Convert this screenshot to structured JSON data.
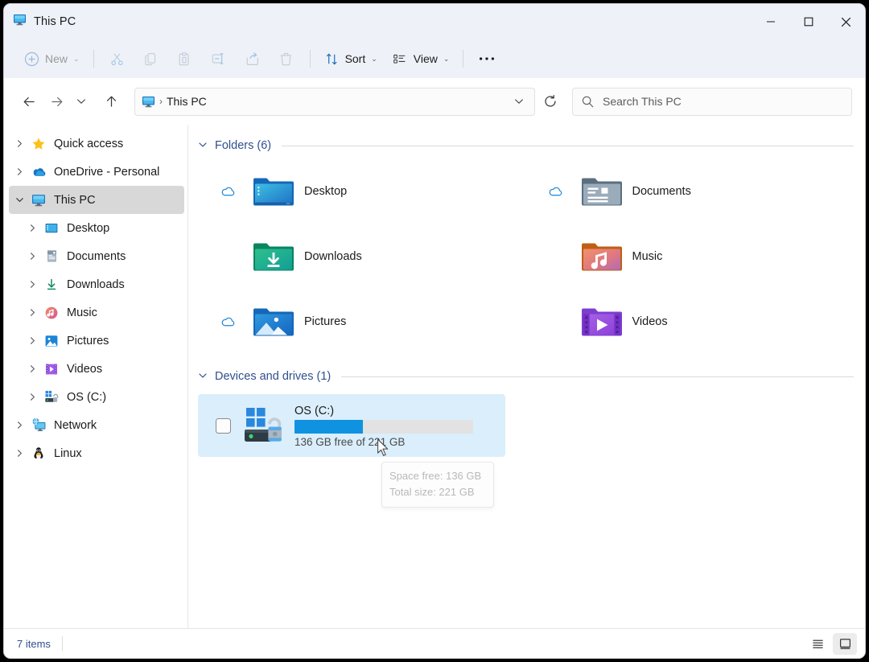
{
  "window": {
    "title": "This PC",
    "controls": {
      "minimize": "–",
      "maximize": "□",
      "close": "✕"
    }
  },
  "toolbar": {
    "new_label": "New",
    "cut_label": "Cut",
    "copy_label": "Copy",
    "paste_label": "Paste",
    "rename_label": "Rename",
    "share_label": "Share",
    "delete_label": "Delete",
    "sort_label": "Sort",
    "view_label": "View",
    "more_label": "See more"
  },
  "navigation": {
    "back": "Back",
    "forward": "Forward",
    "recent": "Recent locations",
    "up": "Up to parent",
    "breadcrumb": {
      "icon": "this-pc-icon",
      "separator": "›",
      "label": "This PC"
    },
    "address_dropdown": "Previous locations",
    "refresh": "Refresh"
  },
  "search": {
    "placeholder": "Search This PC",
    "value": ""
  },
  "sidebar": {
    "items": [
      {
        "label": "Quick access",
        "icon": "star-icon",
        "level": 1,
        "expander": "collapsed",
        "selected": false
      },
      {
        "label": "OneDrive - Personal",
        "icon": "onedrive-icon",
        "level": 1,
        "expander": "collapsed",
        "selected": false
      },
      {
        "label": "This PC",
        "icon": "this-pc-icon",
        "level": 1,
        "expander": "expanded",
        "selected": true
      },
      {
        "label": "Desktop",
        "icon": "desktop-icon",
        "level": 2,
        "expander": "collapsed",
        "selected": false
      },
      {
        "label": "Documents",
        "icon": "documents-icon",
        "level": 2,
        "expander": "collapsed",
        "selected": false
      },
      {
        "label": "Downloads",
        "icon": "downloads-icon",
        "level": 2,
        "expander": "collapsed",
        "selected": false
      },
      {
        "label": "Music",
        "icon": "music-icon",
        "level": 2,
        "expander": "collapsed",
        "selected": false
      },
      {
        "label": "Pictures",
        "icon": "pictures-icon",
        "level": 2,
        "expander": "collapsed",
        "selected": false
      },
      {
        "label": "Videos",
        "icon": "videos-icon",
        "level": 2,
        "expander": "collapsed",
        "selected": false
      },
      {
        "label": "OS (C:)",
        "icon": "drive-icon",
        "level": 2,
        "expander": "collapsed",
        "selected": false
      },
      {
        "label": "Network",
        "icon": "network-icon",
        "level": 1,
        "expander": "collapsed",
        "selected": false
      },
      {
        "label": "Linux",
        "icon": "linux-icon",
        "level": 1,
        "expander": "collapsed",
        "selected": false
      }
    ]
  },
  "main": {
    "groups": [
      {
        "title": "Folders (6)",
        "chevron": "expanded"
      },
      {
        "title": "Devices and drives (1)",
        "chevron": "expanded"
      }
    ],
    "folders": [
      {
        "name": "Desktop",
        "icon": "folder-desktop-icon",
        "cloud": "cloud-online-icon"
      },
      {
        "name": "Documents",
        "icon": "folder-documents-icon",
        "cloud": "cloud-online-icon"
      },
      {
        "name": "Downloads",
        "icon": "folder-downloads-icon",
        "cloud": ""
      },
      {
        "name": "Music",
        "icon": "folder-music-icon",
        "cloud": ""
      },
      {
        "name": "Pictures",
        "icon": "folder-pictures-icon",
        "cloud": "cloud-online-icon"
      },
      {
        "name": "Videos",
        "icon": "folder-videos-icon",
        "cloud": ""
      }
    ],
    "drives": [
      {
        "name": "OS (C:)",
        "icon": "drive-bitlocker-unlocked-icon",
        "free_text": "136 GB free of 221 GB",
        "free_gb": 136,
        "total_gb": 221,
        "used_percent": 38.5,
        "selected": true,
        "checked": false
      }
    ],
    "tooltip": {
      "visible": true,
      "line1": "Space free: 136 GB",
      "line2": "Total size: 221 GB"
    }
  },
  "statusbar": {
    "item_count": "7 items",
    "details_view": "Details view",
    "large_icons_view": "Large icons view",
    "active_view": "large-icons"
  },
  "colors": {
    "accent": "#0f93e0",
    "group_header": "#2f4f8f",
    "selection_bg": "#daeefc",
    "sidebar_selected": "#d8d8d8",
    "chrome_bg": "#eef1f8"
  }
}
